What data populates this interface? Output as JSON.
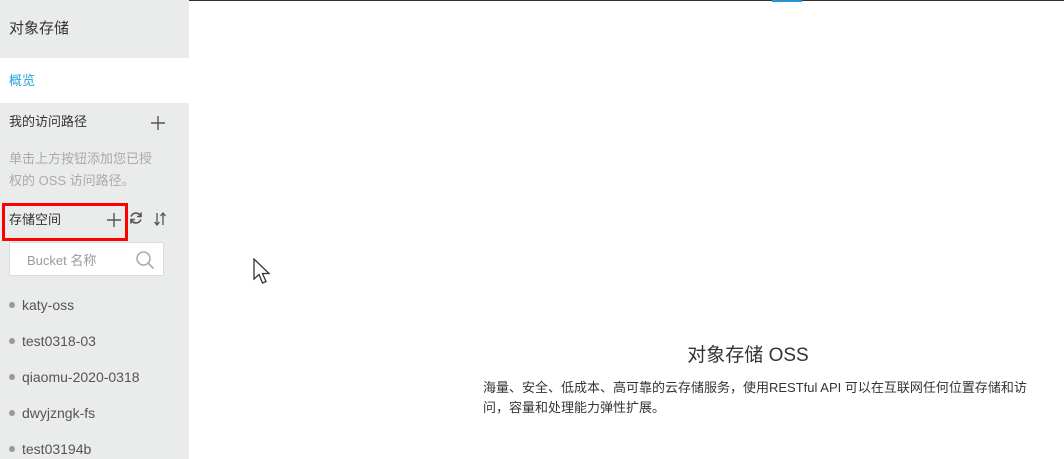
{
  "sidebar": {
    "title": "对象存储",
    "overview": "概览",
    "access_paths_label": "我的访问路径",
    "access_paths_hint": "单击上方按钮添加您已授权的 OSS 访问路径。",
    "buckets_label": "存储空间",
    "search_placeholder": "Bucket 名称",
    "buckets": [
      {
        "name": "katy-oss"
      },
      {
        "name": "test0318-03"
      },
      {
        "name": "qiaomu-2020-0318"
      },
      {
        "name": "dwyjzngk-fs"
      },
      {
        "name": "test03194b"
      }
    ]
  },
  "main": {
    "title": "对象存储 OSS",
    "description": "海量、安全、低成本、高可靠的云存储服务，使用RESTful API 可以在互联网任何位置存储和访问，容量和处理能力弹性扩展。"
  },
  "colors": {
    "accent": "#26a6d9",
    "highlight_box": "#ff0000",
    "sidebar_bg": "#eaebeb"
  }
}
